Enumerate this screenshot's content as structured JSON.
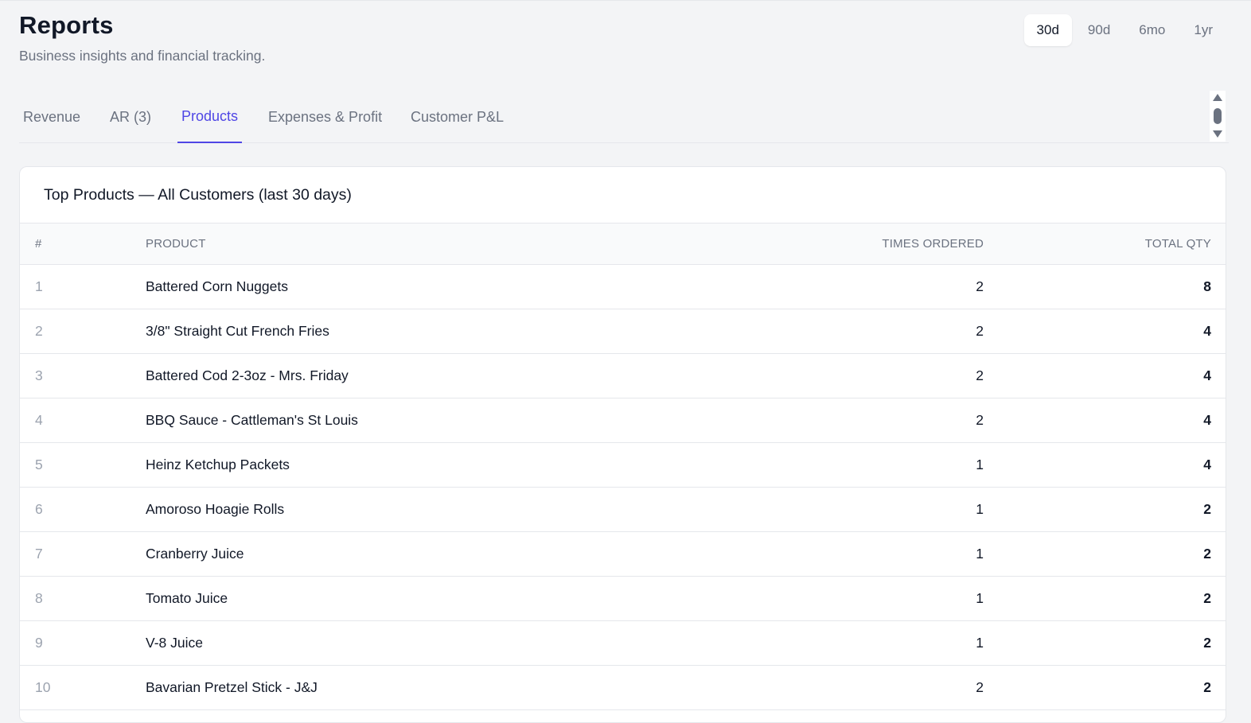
{
  "header": {
    "title": "Reports",
    "subtitle": "Business insights and financial tracking."
  },
  "range": {
    "options": [
      "30d",
      "90d",
      "6mo",
      "1yr"
    ],
    "selected": "30d"
  },
  "tabs": [
    {
      "label": "Revenue",
      "active": false
    },
    {
      "label": "AR (3)",
      "active": false
    },
    {
      "label": "Products",
      "active": true
    },
    {
      "label": "Expenses & Profit",
      "active": false
    },
    {
      "label": "Customer P&L",
      "active": false
    }
  ],
  "card": {
    "title": "Top Products — All Customers (last 30 days)",
    "columns": {
      "num": "#",
      "product": "Product",
      "times_ordered": "Times Ordered",
      "total_qty": "Total Qty"
    },
    "rows": [
      {
        "num": "1",
        "product": "Battered Corn Nuggets",
        "times": "2",
        "qty": "8"
      },
      {
        "num": "2",
        "product": "3/8\" Straight Cut French Fries",
        "times": "2",
        "qty": "4"
      },
      {
        "num": "3",
        "product": "Battered Cod 2-3oz - Mrs. Friday",
        "times": "2",
        "qty": "4"
      },
      {
        "num": "4",
        "product": "BBQ Sauce - Cattleman's St Louis",
        "times": "2",
        "qty": "4"
      },
      {
        "num": "5",
        "product": "Heinz Ketchup Packets",
        "times": "1",
        "qty": "4"
      },
      {
        "num": "6",
        "product": "Amoroso Hoagie Rolls",
        "times": "1",
        "qty": "2"
      },
      {
        "num": "7",
        "product": "Cranberry Juice",
        "times": "1",
        "qty": "2"
      },
      {
        "num": "8",
        "product": "Tomato Juice",
        "times": "1",
        "qty": "2"
      },
      {
        "num": "9",
        "product": "V-8 Juice",
        "times": "1",
        "qty": "2"
      },
      {
        "num": "10",
        "product": "Bavarian Pretzel Stick - J&J",
        "times": "2",
        "qty": "2"
      }
    ]
  },
  "colors": {
    "accent": "#4f46e5",
    "background": "#f3f4f6",
    "muted_text": "#6b7280"
  }
}
